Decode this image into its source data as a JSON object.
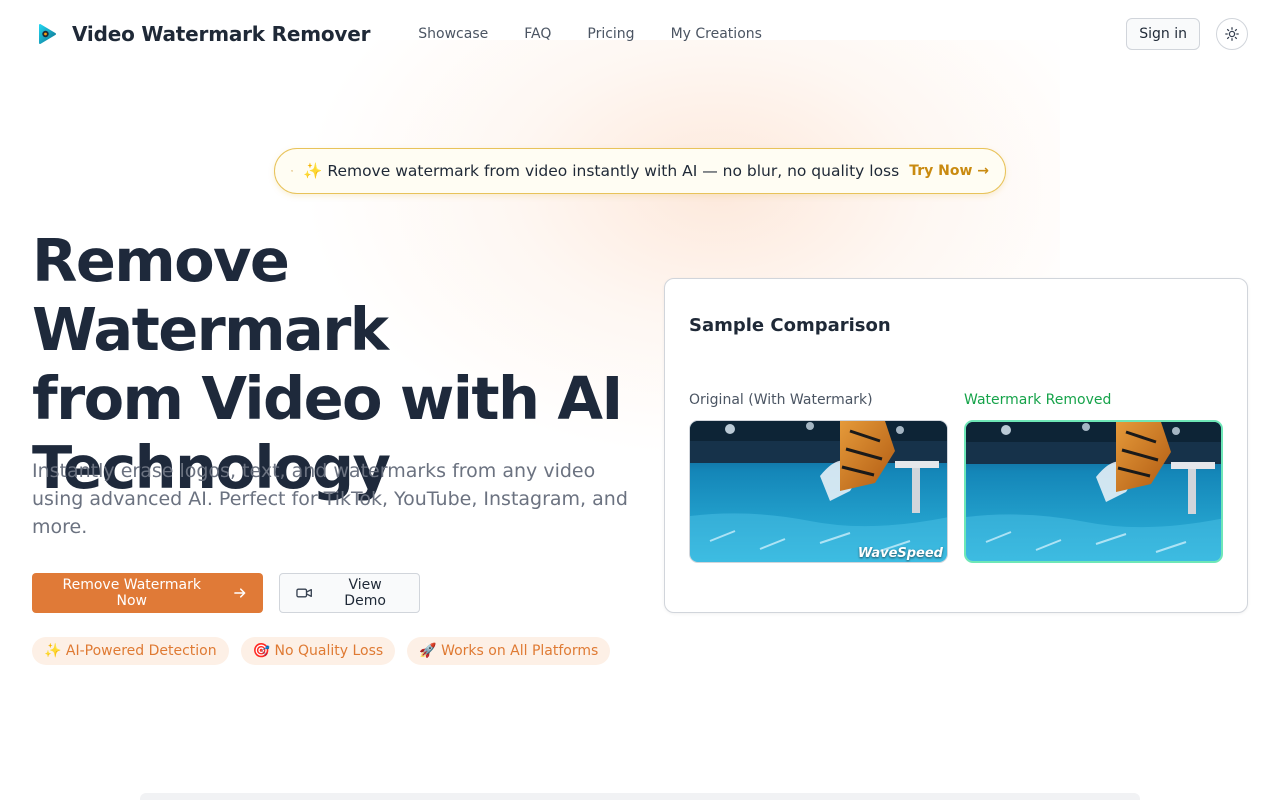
{
  "header": {
    "brand": "Video Watermark Remover",
    "nav": [
      "Showcase",
      "FAQ",
      "Pricing",
      "My Creations"
    ],
    "signin_label": "Sign in"
  },
  "announcement": {
    "icon": "trophy-icon",
    "text": "✨ Remove watermark from video instantly with AI — no blur, no quality loss",
    "cta": "Try Now →"
  },
  "hero": {
    "title_lines": [
      "Remove Watermark",
      "from Video with AI",
      "Technology"
    ],
    "subtitle": "Instantly erase logos, text, and watermarks from any video using advanced AI. Perfect for TikTok, YouTube, Instagram, and more.",
    "primary_cta": "Remove Watermark Now",
    "secondary_cta": "View Demo",
    "chips": [
      "✨ AI-Powered Detection",
      "🎯 No Quality Loss",
      "🚀 Works on All Platforms"
    ]
  },
  "comparison": {
    "title": "Sample Comparison",
    "original_label": "Original (With Watermark)",
    "removed_label": "Watermark Removed",
    "watermark_text": "WaveSpeed"
  },
  "colors": {
    "accent": "#e07a37",
    "announce_border": "#e8c35a",
    "try_now": "#c98a10",
    "success": "#16a34a",
    "removed_border": "#6ee7b7"
  }
}
